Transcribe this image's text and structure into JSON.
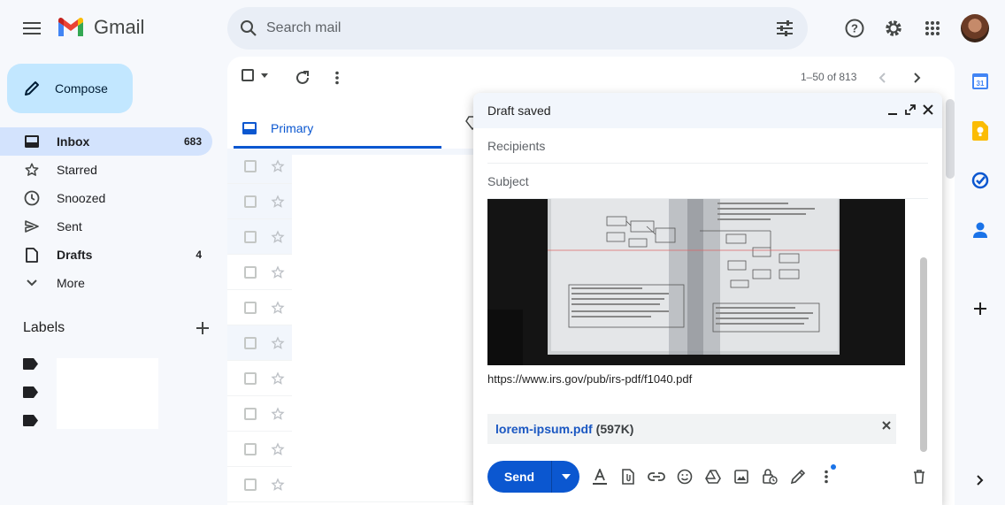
{
  "app": {
    "name": "Gmail"
  },
  "search": {
    "placeholder": "Search mail"
  },
  "compose_button": {
    "label": "Compose"
  },
  "nav": [
    {
      "label": "Inbox",
      "count": "683",
      "icon": "inbox-icon"
    },
    {
      "label": "Starred",
      "count": "",
      "icon": "star-icon"
    },
    {
      "label": "Snoozed",
      "count": "",
      "icon": "clock-icon"
    },
    {
      "label": "Sent",
      "count": "",
      "icon": "send-icon"
    },
    {
      "label": "Drafts",
      "count": "4",
      "icon": "draft-icon"
    },
    {
      "label": "More",
      "count": "",
      "icon": "chevron-down-icon"
    }
  ],
  "labels": {
    "title": "Labels"
  },
  "toolbar": {
    "pagination": "1–50 of 813"
  },
  "tabs": [
    {
      "label": "Primary"
    }
  ],
  "compose_window": {
    "title": "Draft saved",
    "recipients_placeholder": "Recipients",
    "subject_placeholder": "Subject",
    "body_url": "https://www.irs.gov/pub/irs-pdf/f1040.pdf",
    "attachment": {
      "name": "lorem-ipsum.pdf",
      "size": "(597K)"
    },
    "send_label": "Send"
  },
  "colors": {
    "accent": "#0b57d0",
    "compose_bg": "#c2e7ff",
    "active_nav": "#d3e3fd"
  }
}
